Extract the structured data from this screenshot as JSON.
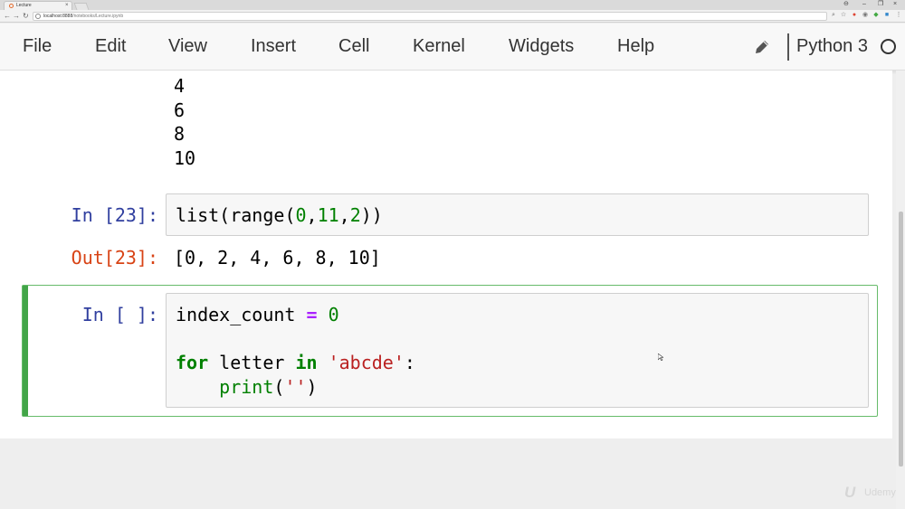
{
  "browser": {
    "tab_title": "Lecture",
    "tab_close": "×",
    "window_controls": [
      "⊖",
      "–",
      "❐",
      "×"
    ],
    "nav": {
      "back": "←",
      "forward": "→",
      "reload": "↻"
    },
    "url_host": "localhost:8888",
    "url_path": "/notebooks/Lecture.ipynb",
    "extension_icons": [
      "search-icon",
      "star-icon",
      "ext-icon",
      "ext-icon",
      "ext-icon",
      "menu-icon"
    ]
  },
  "menubar": {
    "items": [
      "File",
      "Edit",
      "View",
      "Insert",
      "Cell",
      "Kernel",
      "Widgets",
      "Help"
    ],
    "kernel_name": "Python 3"
  },
  "cells": {
    "stream_output": [
      "4",
      "6",
      "8",
      "10"
    ],
    "cell23": {
      "in_prompt": "In [23]:",
      "code": {
        "fn1": "list",
        "p1": "(",
        "fn2": "range",
        "p2": "(",
        "a": "0",
        "c1": ",",
        "b": "11",
        "c2": ",",
        "c": "2",
        "p3": "))"
      },
      "out_prompt": "Out[23]:",
      "output": "[0, 2, 4, 6, 8, 10]"
    },
    "current": {
      "in_prompt": "In [ ]:",
      "line1": {
        "var": "index_count ",
        "eq": "=",
        "sp": " ",
        "val": "0"
      },
      "line3": {
        "kw_for": "for",
        "mid": " letter ",
        "kw_in": "in",
        "sp": " ",
        "str": "'abcde'",
        "colon": ":"
      },
      "line4": {
        "indent": "    ",
        "fn": "print",
        "p1": "(",
        "str": "''",
        "p2": ")"
      }
    }
  },
  "watermark": {
    "logo": "U",
    "text": "Udemy"
  },
  "colors": {
    "prompt_in": "#303f9f",
    "prompt_out": "#d84315",
    "selected_border": "#66bb6a",
    "keyword": "#008000",
    "string": "#ba2121"
  }
}
